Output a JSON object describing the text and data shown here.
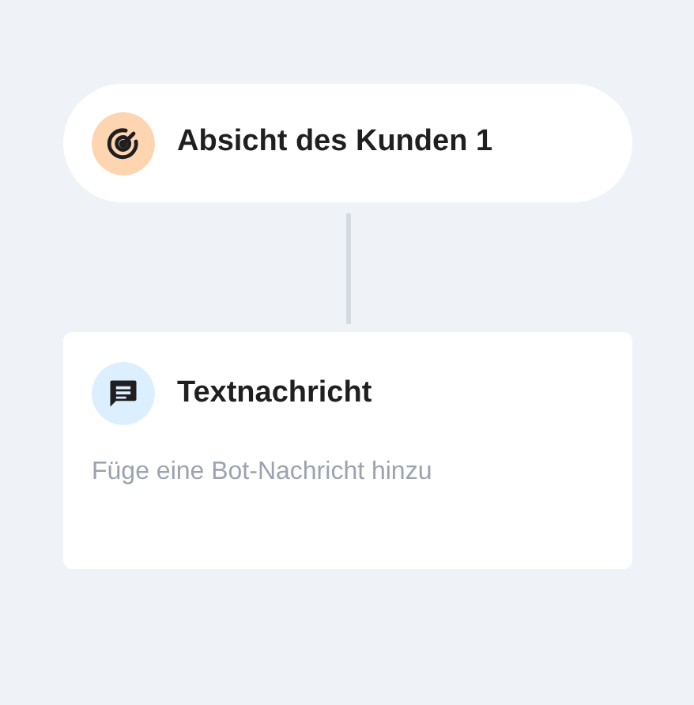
{
  "intent": {
    "title": "Absicht des Kunden 1"
  },
  "message_card": {
    "title": "Textnachricht",
    "hint": "Füge eine Bot-Nachricht hinzu"
  }
}
